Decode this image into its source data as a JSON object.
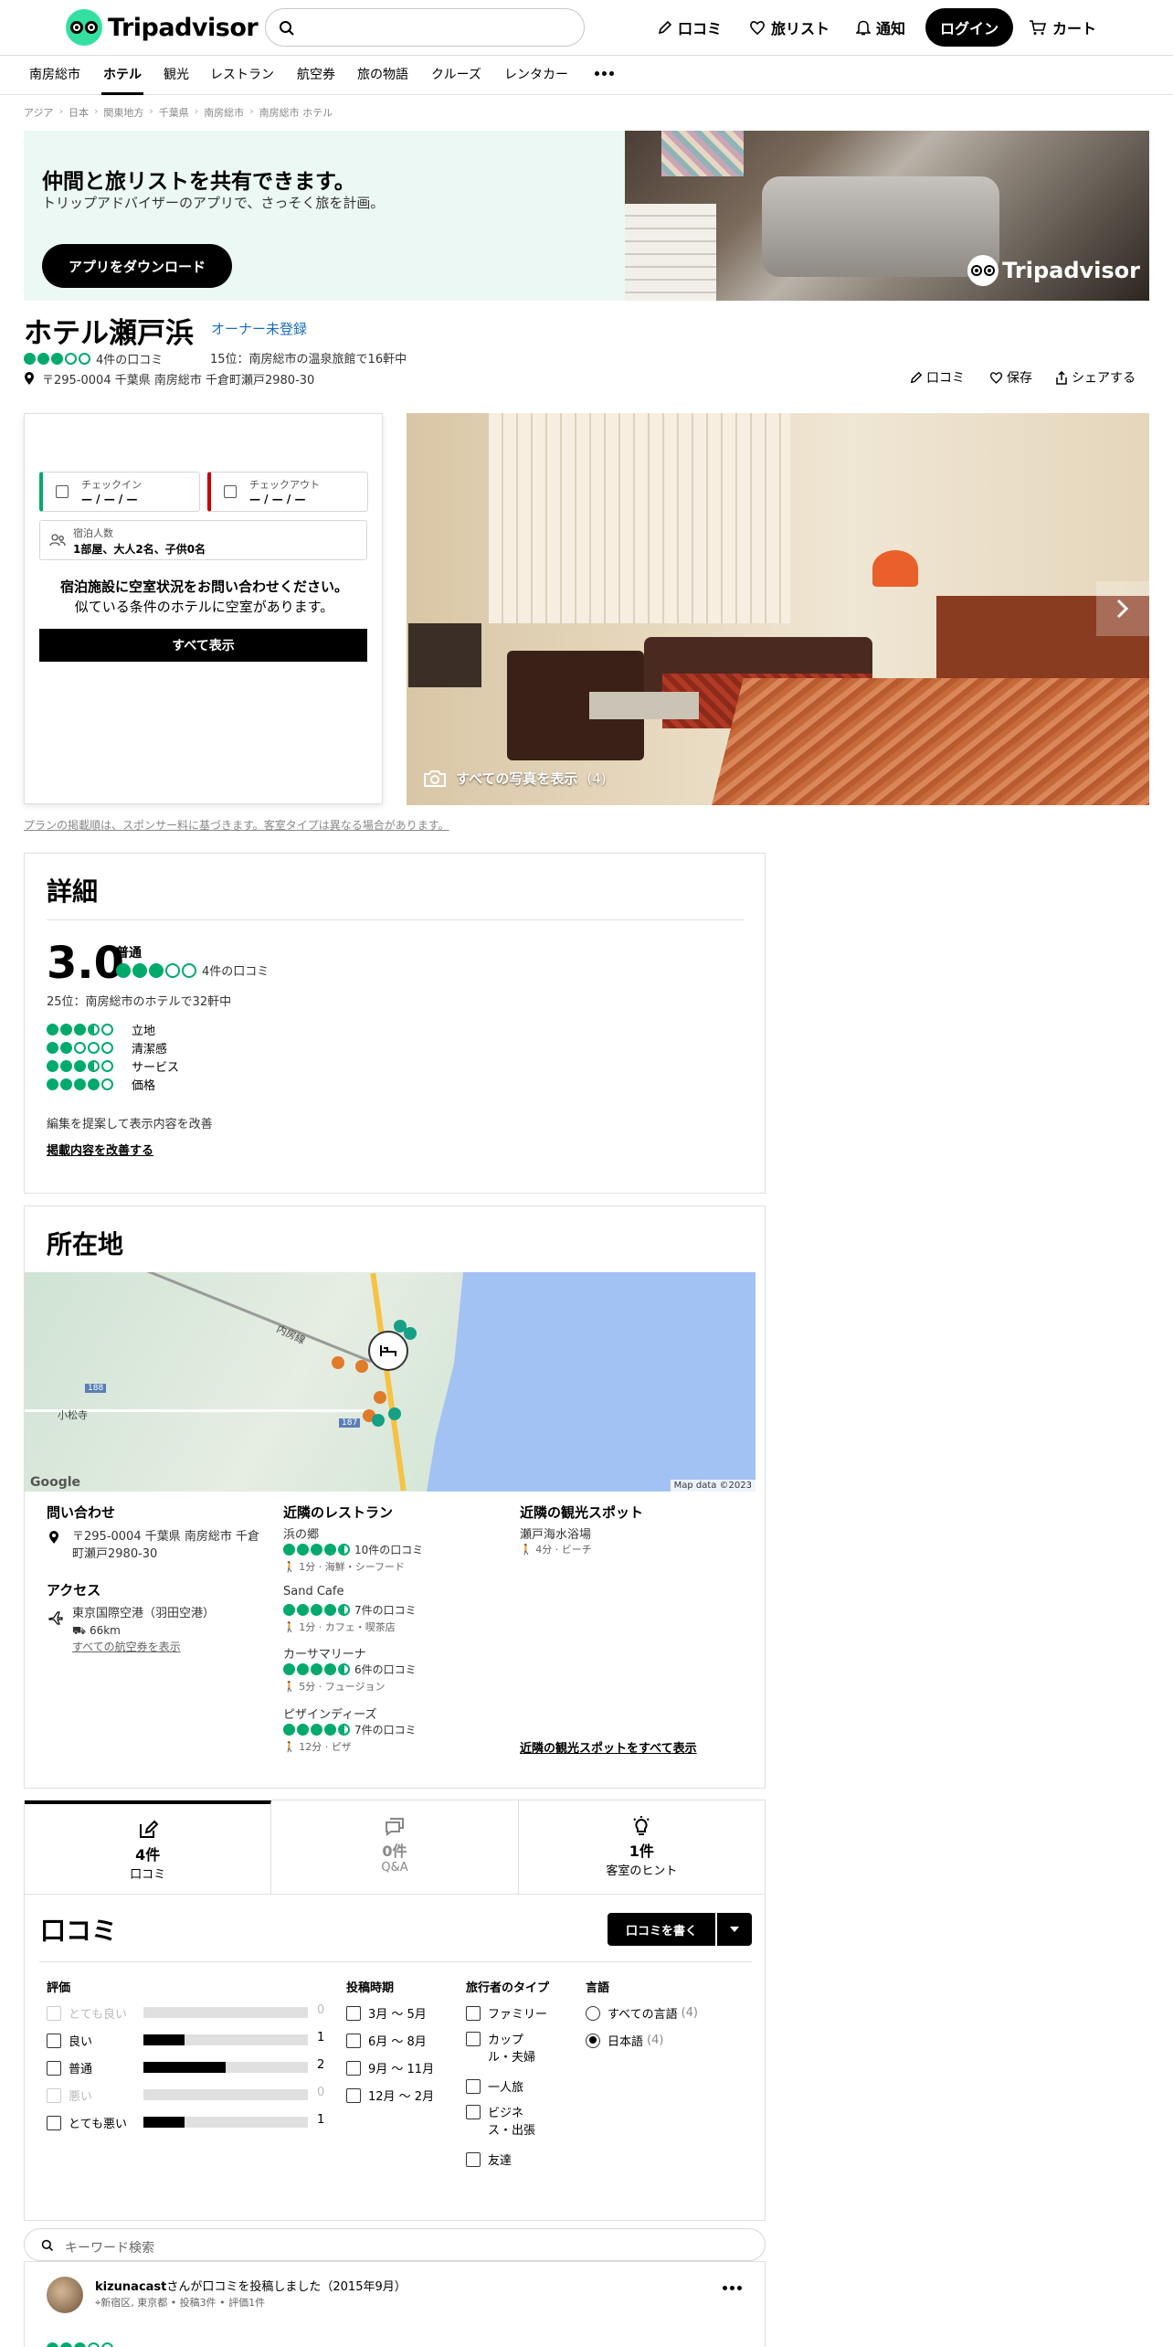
{
  "header": {
    "brand": "Tripadvisor",
    "nav": [
      "口コミ",
      "旅リスト",
      "通知"
    ],
    "login": "ログイン",
    "cart": "カート"
  },
  "categories": [
    "南房総市",
    "ホテル",
    "観光",
    "レストラン",
    "航空券",
    "旅の物語",
    "クルーズ",
    "レンタカー"
  ],
  "breadcrumb": [
    "アジア",
    "日本",
    "関東地方",
    "千葉県",
    "南房総市",
    "南房総市 ホテル"
  ],
  "banner": {
    "title": "仲間と旅リストを共有できます。",
    "subtitle": "トリップアドバイザーのアプリで、さっそく旅を計画。",
    "button": "アプリをダウンロード",
    "logo_text": "Tripadvisor"
  },
  "hotel": {
    "name": "ホテル瀬戸浜",
    "owner_link": "オーナー未登録",
    "reviews_count": "4件の口コミ",
    "rating": 3.0,
    "rank": "15位：南房総市の温泉旅館で16軒中",
    "address": "〒295-0004 千葉県 南房総市 千倉町瀬戸2980-30",
    "actions": [
      "口コミ",
      "保存",
      "シェアする"
    ]
  },
  "booking": {
    "checkin_label": "チェックイン",
    "checkin_value": "— / — / —",
    "checkout_label": "チェックアウト",
    "checkout_value": "— / — / —",
    "guests_label": "宿泊人数",
    "guests_value": "1部屋、大人2名、子供0名",
    "message": "宿泊施設に空室状況をお問い合わせください。",
    "message_sub": "似ている条件のホテルに空室があります。",
    "button": "すべて表示"
  },
  "photo": {
    "show_all": "すべての写真を表示",
    "count": "(4)"
  },
  "disclaimer": "プランの掲載順は、スポンサー料に基づきます。客室タイプは異なる場合があります。",
  "details": {
    "title": "詳細",
    "score": "3.0",
    "score_word": "普通",
    "reviews": "4件の口コミ",
    "rank": "25位：南房総市のホテルで32軒中",
    "subratings": [
      {
        "label": "立地",
        "value": 3.5
      },
      {
        "label": "清潔感",
        "value": 2.0
      },
      {
        "label": "サービス",
        "value": 3.5
      },
      {
        "label": "価格",
        "value": 4.0
      }
    ],
    "edit_note": "編集を提案して表示内容を改善",
    "edit_link": "掲載内容を改善する"
  },
  "location": {
    "title": "所在地",
    "map_labels": [
      "内房線",
      "小松寺",
      "188",
      "187"
    ],
    "map_brand": "Google",
    "map_copyright": "Map data ©2023",
    "contact_title": "問い合わせ",
    "contact_address": "〒295-0004 千葉県 南房総市 千倉町瀬戸2980-30",
    "access_title": "アクセス",
    "airport": "東京国際空港（羽田空港）",
    "airport_distance": "66km",
    "airport_link": "すべての航空券を表示",
    "restaurants_title": "近隣のレストラン",
    "restaurants": [
      {
        "name": "浜の郷",
        "rating": 4.5,
        "reviews": "10件の口コミ",
        "meta": "1分 · 海鮮・シーフード"
      },
      {
        "name": "Sand Cafe",
        "rating": 4.5,
        "reviews": "7件の口コミ",
        "meta": "1分 · カフェ・喫茶店"
      },
      {
        "name": "カーサマリーナ",
        "rating": 4.5,
        "reviews": "6件の口コミ",
        "meta": "5分 · フュージョン"
      },
      {
        "name": "ピザインディーズ",
        "rating": 4.5,
        "reviews": "7件の口コミ",
        "meta": "12分 · ピザ"
      }
    ],
    "sights_title": "近隣の観光スポット",
    "sight_name": "瀬戸海水浴場",
    "sight_meta": "4分 · ビーチ",
    "sights_link": "近隣の観光スポットをすべて表示"
  },
  "tabs": [
    {
      "num": "4件",
      "label": "口コミ"
    },
    {
      "num": "0件",
      "label": "Q&A"
    },
    {
      "num": "1件",
      "label": "客室のヒント"
    }
  ],
  "reviews": {
    "title": "口コミ",
    "write": "口コミを書く",
    "filter_rating": "評価",
    "rating_levels": [
      {
        "label": "とても良い",
        "count": "0",
        "fraction": 0
      },
      {
        "label": "良い",
        "count": "1",
        "fraction": 0.25
      },
      {
        "label": "普通",
        "count": "2",
        "fraction": 0.5
      },
      {
        "label": "悪い",
        "count": "0",
        "fraction": 0
      },
      {
        "label": "とても悪い",
        "count": "1",
        "fraction": 0.25
      }
    ],
    "filter_period": "投稿時期",
    "periods": [
      "3月 ～ 5月",
      "6月 ～ 8月",
      "9月 ～ 11月",
      "12月 ～ 2月"
    ],
    "filter_type": "旅行者のタイプ",
    "types": [
      "ファミリー",
      "カップル・夫婦",
      "一人旅",
      "ビジネス・出張",
      "友達"
    ],
    "filter_lang": "言語",
    "langs": [
      {
        "label": "すべての言語",
        "count": "(4)"
      },
      {
        "label": "日本語",
        "count": "(4)"
      }
    ],
    "keyword_placeholder": "キーワード検索"
  },
  "review_item": {
    "user": "kizunacast",
    "action": "さんが口コミを投稿しました（2015年9月）",
    "meta": "新宿区, 東京都 • 投稿3件 • 評価1件",
    "rating": 3
  }
}
